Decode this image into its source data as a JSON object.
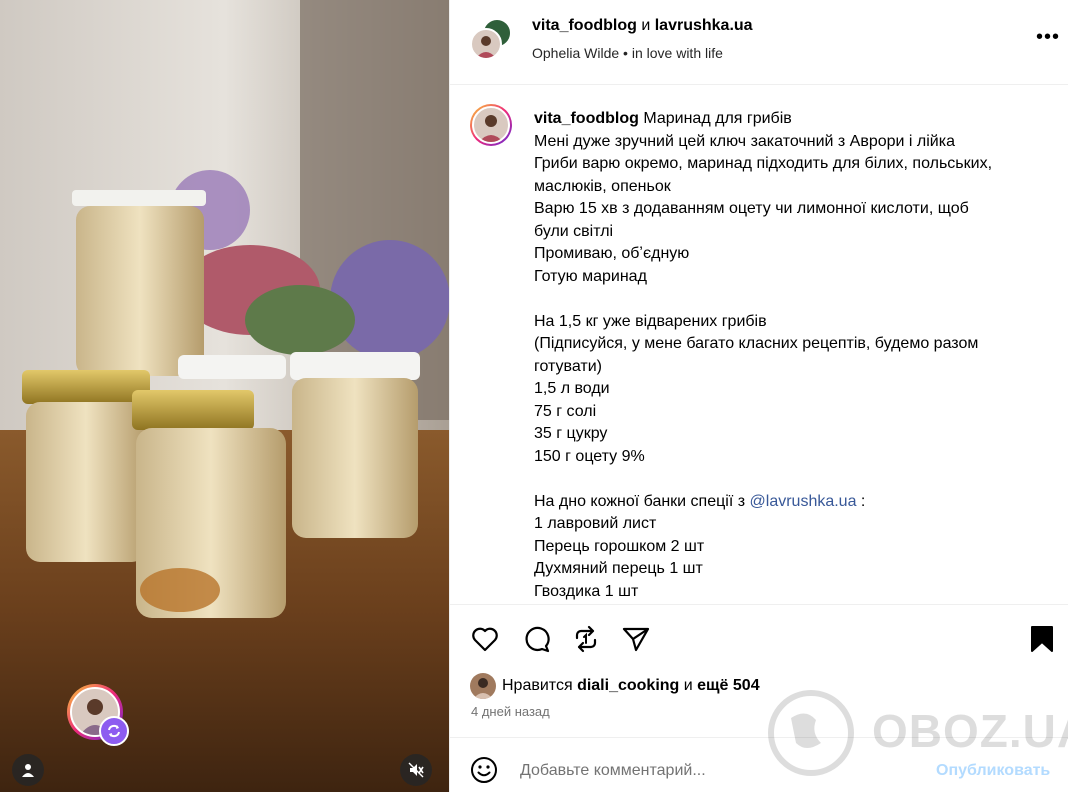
{
  "header": {
    "author": "vita_foodblog",
    "connector": "и",
    "collaborator": "lavrushka.ua",
    "audio_artist": "Ophelia Wilde",
    "bullet": "•",
    "audio_title": "in love with life",
    "more_label": "•••"
  },
  "caption": {
    "username": "vita_foodblog",
    "title": "Маринад для грибів",
    "lines": [
      "Мені дуже зручний цей ключ закаточний з Аврори і лійка",
      "Гриби варю окремо, маринад підходить для білих, польських,",
      "маслюків, опеньок",
      "Варю 15 хв з додаванням оцету чи лимонної кислоти, щоб",
      "були світлі",
      "Промиваю, обʼєдную",
      "Готую маринад",
      "",
      "На 1,5 кг уже відварених грибів",
      "(Підписуйся, у мене багато класних рецептів, будемо разом",
      "готувати)",
      "1,5 л води",
      "75 г солі",
      "35 г цукру",
      "150 г оцету 9%",
      ""
    ],
    "mention_prefix": "На дно кожної банки спеції з ",
    "mention": "@lavrushka.ua",
    "mention_suffix": " :",
    "tail_lines": [
      "1 лавровий лист",
      "Перець горошком 2 шт",
      "Духмяний перець 1 шт",
      "Гвоздика 1 шт"
    ]
  },
  "actions": {
    "like_icon": "heart-icon",
    "comment_icon": "comment-icon",
    "repost_icon": "repost-icon",
    "share_icon": "send-icon",
    "save_icon": "bookmark-icon"
  },
  "likes": {
    "prefix": "Нравится",
    "user": "diali_cooking",
    "connector": "и",
    "others": "ещё 504"
  },
  "timestamp": "4 дней назад",
  "comment": {
    "placeholder": "Добавьте комментарий...",
    "post_label": "Опубликовать"
  },
  "watermark": "OBOZ.UA",
  "colors": {
    "mention": "#385898",
    "post_disabled": "#b3dbff",
    "divider": "#efefef",
    "collab_badge": "#8d5cf0"
  }
}
